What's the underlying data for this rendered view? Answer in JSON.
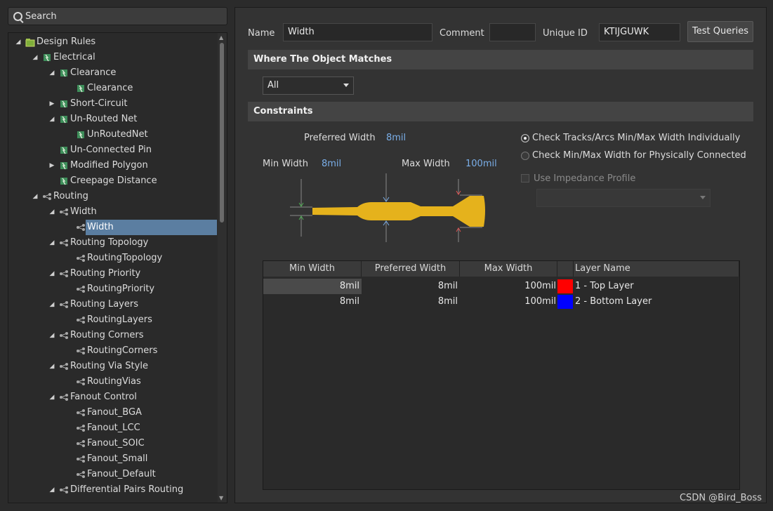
{
  "search": {
    "placeholder": "Search"
  },
  "tree": [
    {
      "label": "Design Rules",
      "level": 0,
      "arrow": "down",
      "icon": "rules-folder-icon"
    },
    {
      "label": "Electrical",
      "level": 1,
      "arrow": "down",
      "icon": "electrical-category-icon"
    },
    {
      "label": "Clearance",
      "level": 2,
      "arrow": "down",
      "icon": "electrical-rule-icon"
    },
    {
      "label": "Clearance",
      "level": 3,
      "arrow": "",
      "icon": "electrical-rule-icon"
    },
    {
      "label": "Short-Circuit",
      "level": 2,
      "arrow": "right",
      "icon": "electrical-rule-icon"
    },
    {
      "label": "Un-Routed Net",
      "level": 2,
      "arrow": "down",
      "icon": "electrical-rule-icon"
    },
    {
      "label": "UnRoutedNet",
      "level": 3,
      "arrow": "",
      "icon": "electrical-rule-icon"
    },
    {
      "label": "Un-Connected Pin",
      "level": 2,
      "arrow": "",
      "icon": "electrical-rule-icon"
    },
    {
      "label": "Modified Polygon",
      "level": 2,
      "arrow": "right",
      "icon": "electrical-rule-icon"
    },
    {
      "label": "Creepage Distance",
      "level": 2,
      "arrow": "",
      "icon": "electrical-rule-icon"
    },
    {
      "label": "Routing",
      "level": 1,
      "arrow": "down",
      "icon": "routing-category-icon"
    },
    {
      "label": "Width",
      "level": 2,
      "arrow": "down",
      "icon": "routing-rule-icon"
    },
    {
      "label": "Width",
      "level": 3,
      "arrow": "",
      "icon": "routing-rule-icon",
      "selected": true
    },
    {
      "label": "Routing Topology",
      "level": 2,
      "arrow": "down",
      "icon": "routing-rule-icon"
    },
    {
      "label": "RoutingTopology",
      "level": 3,
      "arrow": "",
      "icon": "routing-rule-icon"
    },
    {
      "label": "Routing Priority",
      "level": 2,
      "arrow": "down",
      "icon": "routing-rule-icon"
    },
    {
      "label": "RoutingPriority",
      "level": 3,
      "arrow": "",
      "icon": "routing-rule-icon"
    },
    {
      "label": "Routing Layers",
      "level": 2,
      "arrow": "down",
      "icon": "routing-rule-icon"
    },
    {
      "label": "RoutingLayers",
      "level": 3,
      "arrow": "",
      "icon": "routing-rule-icon"
    },
    {
      "label": "Routing Corners",
      "level": 2,
      "arrow": "down",
      "icon": "routing-rule-icon"
    },
    {
      "label": "RoutingCorners",
      "level": 3,
      "arrow": "",
      "icon": "routing-rule-icon"
    },
    {
      "label": "Routing Via Style",
      "level": 2,
      "arrow": "down",
      "icon": "routing-rule-icon"
    },
    {
      "label": "RoutingVias",
      "level": 3,
      "arrow": "",
      "icon": "routing-rule-icon"
    },
    {
      "label": "Fanout Control",
      "level": 2,
      "arrow": "down",
      "icon": "routing-rule-icon"
    },
    {
      "label": "Fanout_BGA",
      "level": 3,
      "arrow": "",
      "icon": "routing-rule-icon"
    },
    {
      "label": "Fanout_LCC",
      "level": 3,
      "arrow": "",
      "icon": "routing-rule-icon"
    },
    {
      "label": "Fanout_SOIC",
      "level": 3,
      "arrow": "",
      "icon": "routing-rule-icon"
    },
    {
      "label": "Fanout_Small",
      "level": 3,
      "arrow": "",
      "icon": "routing-rule-icon"
    },
    {
      "label": "Fanout_Default",
      "level": 3,
      "arrow": "",
      "icon": "routing-rule-icon"
    },
    {
      "label": "Differential Pairs Routing",
      "level": 2,
      "arrow": "down",
      "icon": "routing-rule-icon"
    }
  ],
  "header": {
    "name_label": "Name",
    "name_value": "Width",
    "comment_label": "Comment",
    "comment_value": "",
    "uid_label": "Unique ID",
    "uid_value": "KTIJGUWK",
    "test_queries": "Test Queries"
  },
  "where": {
    "title": "Where The Object Matches",
    "selected": "All"
  },
  "constraints": {
    "title": "Constraints",
    "preferred_label": "Preferred Width",
    "preferred_value": "8mil",
    "min_label": "Min Width",
    "min_value": "8mil",
    "max_label": "Max Width",
    "max_value": "100mil",
    "radio1": "Check Tracks/Arcs Min/Max Width Individually",
    "radio2": "Check Min/Max Width for Physically Connected",
    "radio_selected": 1,
    "impedance": "Use Impedance Profile",
    "impedance_select": ""
  },
  "table": {
    "headers": [
      "Min Width",
      "Preferred Width",
      "Max Width",
      "",
      "Layer Name"
    ],
    "rows": [
      {
        "min": "8mil",
        "pref": "8mil",
        "max": "100mil",
        "color": "#ff0000",
        "layer": "1 - Top Layer"
      },
      {
        "min": "8mil",
        "pref": "8mil",
        "max": "100mil",
        "color": "#0000ff",
        "layer": "2 - Bottom Layer"
      }
    ]
  },
  "colors": {
    "accent_blue": "#7aaee8",
    "selection": "#5b7ea1",
    "track": "#e5b21c"
  },
  "watermark": "CSDN @Bird_Boss"
}
